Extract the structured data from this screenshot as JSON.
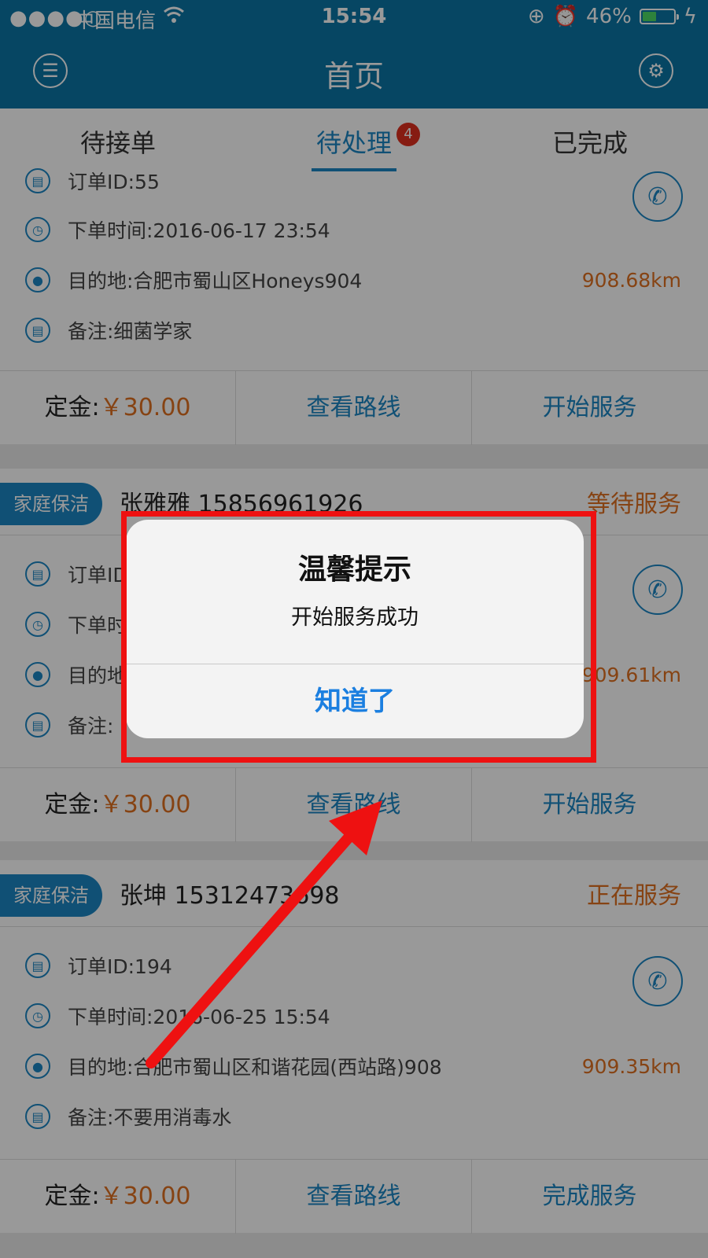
{
  "status_bar": {
    "signal": "●●●●○",
    "carrier": "中国电信",
    "time": "15:54",
    "battery": "46%",
    "battery_level": 0.46
  },
  "navbar": {
    "title": "首页",
    "menu_icon": "list-icon",
    "settings_icon": "gear-icon"
  },
  "tabs": [
    {
      "label": "待接单"
    },
    {
      "label": "待处理",
      "badge": "4",
      "active": true
    },
    {
      "label": "已完成"
    }
  ],
  "orders": [
    {
      "order_id": "订单ID:55",
      "time": "下单时间:2016-06-17 23:54",
      "dest": "目的地:合肥市蜀山区Honeys904",
      "distance": "908.68km",
      "note": "备注:细菌学家",
      "deposit_label": "定金:",
      "deposit_amount": "￥30.00",
      "route": "查看路线",
      "action": "开始服务"
    },
    {
      "service": "家庭保洁",
      "customer": "张雅雅 15856961926",
      "status": "等待服务",
      "order_id": "订单ID",
      "time": "下单时",
      "dest": "目的地",
      "distance": "909.61km",
      "note": "备注:",
      "deposit_label": "定金:",
      "deposit_amount": "￥30.00",
      "route": "查看路线",
      "action": "开始服务"
    },
    {
      "service": "家庭保洁",
      "customer": "张坤 15312473698",
      "status": "正在服务",
      "order_id": "订单ID:194",
      "time": "下单时间:2016-06-25 15:54",
      "dest": "目的地:合肥市蜀山区和谐花园(西站路)908",
      "distance": "909.35km",
      "note": "备注:不要用消毒水",
      "deposit_label": "定金:",
      "deposit_amount": "￥30.00",
      "route": "查看路线",
      "action": "完成服务"
    }
  ],
  "alert": {
    "title": "温馨提示",
    "message": "开始服务成功",
    "button": "知道了"
  },
  "colors": {
    "primary": "#0b76a6",
    "accent": "#1b86c4",
    "orange": "#e07020",
    "highlight": "#ee1111"
  }
}
